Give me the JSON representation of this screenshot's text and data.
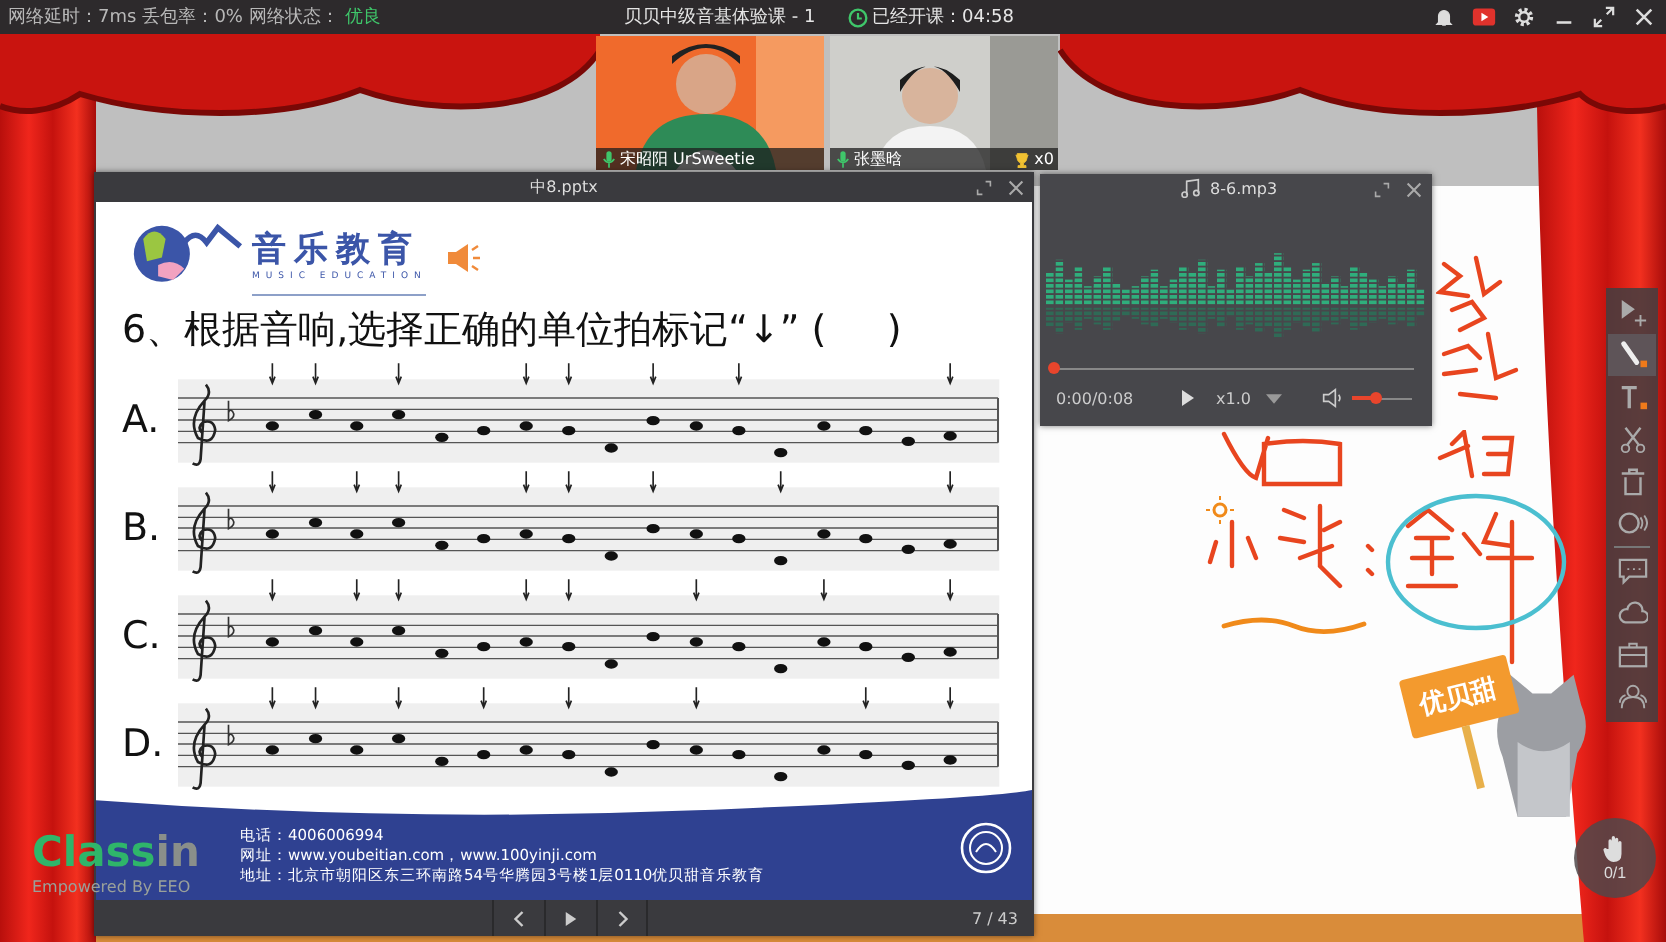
{
  "status": {
    "latency": "网络延时：7ms",
    "packet_loss": "丢包率：0%",
    "network_label": "网络状态：",
    "network_value": "优良"
  },
  "class_title": "贝贝中级音基体验课 - 1",
  "timer": "已经开课：04:58",
  "videos": [
    {
      "name": "宋昭阳 UrSweetie"
    },
    {
      "name": "张墨晗",
      "trophies": "x0"
    }
  ],
  "ppt": {
    "title": "中8.pptx",
    "brand": "音乐教育",
    "brand_sub": "MUSIC EDUCATION",
    "question": "6、根据音响,选择正确的单位拍标记“↓” (     )",
    "options": [
      {
        "label": "A."
      },
      {
        "label": "B."
      },
      {
        "label": "C."
      },
      {
        "label": "D."
      }
    ],
    "footer": [
      "电话：4006006994",
      "网址：www.youbeitian.com，www.100yinji.com",
      "地址：北京市朝阳区东三环南路54号华腾园3号楼1层0110优贝甜音乐教育"
    ],
    "page": "7 / 43"
  },
  "audio": {
    "title": "8-6.mp3",
    "progress": {
      "level": 0
    },
    "time": "0:00/0:08",
    "speed": "x1.0",
    "volume": {
      "level": 0.4
    }
  },
  "tools": [
    {
      "kind": "select",
      "selected": false
    },
    {
      "kind": "pen",
      "selected": true
    },
    {
      "kind": "text",
      "selected": false
    },
    {
      "kind": "scissors",
      "selected": false
    },
    {
      "kind": "trash",
      "selected": false
    },
    {
      "kind": "ripple",
      "selected": false
    },
    {
      "kind": "chat",
      "selected": false
    },
    {
      "kind": "cloud",
      "selected": false
    },
    {
      "kind": "toolbox",
      "selected": false
    },
    {
      "kind": "users",
      "selected": false
    }
  ],
  "hand_raise": {
    "count": "0/1"
  },
  "sign": {
    "text": "优贝甜"
  },
  "logo": {
    "part1": "Class",
    "part2": "in",
    "tagline": "Empowered By EEO"
  }
}
